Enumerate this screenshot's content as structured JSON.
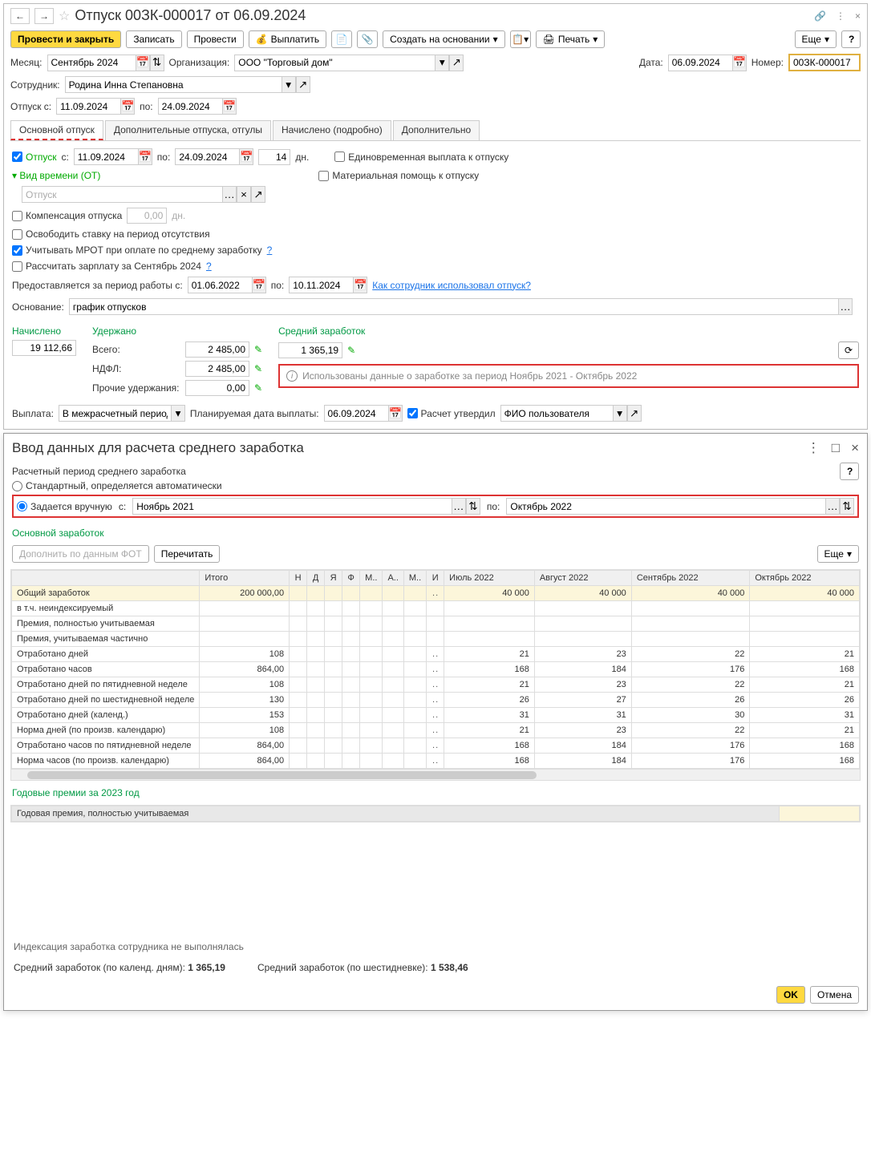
{
  "header": {
    "title": "Отпуск 00ЗК-000017 от 06.09.2024",
    "back": "←",
    "fwd": "→"
  },
  "toolbar": {
    "post_close": "Провести и закрыть",
    "save": "Записать",
    "post": "Провести",
    "pay": "Выплатить",
    "create_base": "Создать на основании",
    "print": "Печать",
    "more": "Еще",
    "help": "?"
  },
  "form": {
    "month_lbl": "Месяц:",
    "month": "Сентябрь 2024",
    "org_lbl": "Организация:",
    "org": "ООО \"Торговый дом\"",
    "date_lbl": "Дата:",
    "date": "06.09.2024",
    "num_lbl": "Номер:",
    "num": "00ЗК-000017",
    "emp_lbl": "Сотрудник:",
    "emp": "Родина Инна Степановна",
    "leave_from_lbl": "Отпуск с:",
    "leave_from": "11.09.2024",
    "to_lbl": "по:",
    "leave_to": "24.09.2024"
  },
  "tabs": {
    "main": "Основной отпуск",
    "add": "Дополнительные отпуска, отгулы",
    "accr": "Начислено (подробно)",
    "extra": "Дополнительно"
  },
  "main_tab": {
    "leave_lbl": "Отпуск",
    "from_lbl": "с:",
    "from": "11.09.2024",
    "to_lbl": "по:",
    "to": "24.09.2024",
    "days": "14",
    "days_lbl": "дн.",
    "lump": "Единовременная выплата к отпуску",
    "mat": "Материальная помощь к отпуску",
    "time_type": "Вид времени (ОТ)",
    "time_type_val": "Отпуск",
    "comp": "Компенсация отпуска",
    "comp_days": "0,00",
    "comp_days_lbl": "дн.",
    "release": "Освободить ставку на период отсутствия",
    "mrot": "Учитывать МРОТ при оплате по среднему заработку",
    "recalc": "Рассчитать зарплату за Сентябрь 2024",
    "provided_lbl": "Предоставляется за период работы с:",
    "provided_from": "01.06.2022",
    "provided_to_lbl": "по:",
    "provided_to": "10.11.2024",
    "how_used": "Как сотрудник использовал отпуск?",
    "basis_lbl": "Основание:",
    "basis": "график отпусков"
  },
  "totals": {
    "accrued_lbl": "Начислено",
    "accrued": "19 112,66",
    "held_lbl": "Удержано",
    "total_lbl": "Всего:",
    "total": "2 485,00",
    "ndfl_lbl": "НДФЛ:",
    "ndfl": "2 485,00",
    "other_lbl": "Прочие удержания:",
    "other": "0,00",
    "avg_lbl": "Средний заработок",
    "avg": "1 365,19",
    "info": "Использованы данные о заработке за период Ноябрь 2021 - Октябрь 2022"
  },
  "payment": {
    "pay_lbl": "Выплата:",
    "pay_val": "В межрасчетный период",
    "plan_date_lbl": "Планируемая дата выплаты:",
    "plan_date": "06.09.2024",
    "approved": "Расчет утвердил",
    "user": "ФИО пользователя"
  },
  "dialog": {
    "title": "Ввод данных для расчета среднего заработка",
    "period_lbl": "Расчетный период среднего заработка",
    "std": "Стандартный, определяется автоматически",
    "manual": "Задается вручную",
    "from_lbl": "с:",
    "from": "Ноябрь 2021",
    "to_lbl": "по:",
    "to": "Октябрь 2022",
    "main_earn": "Основной заработок",
    "supplement": "Дополнить по данным ФОТ",
    "reread": "Перечитать",
    "more": "Еще",
    "annual_bonus": "Годовые премии за 2023 год",
    "annual_bonus_row": "Годовая премия, полностью учитываемая",
    "indexation": "Индексация заработка сотрудника не выполнялась",
    "avg_calendar_lbl": "Средний заработок (по календ. дням):",
    "avg_calendar": "1 365,19",
    "avg_six_lbl": "Средний заработок (по шестидневке):",
    "avg_six": "1 538,46",
    "ok": "OK",
    "cancel": "Отмена",
    "help": "?"
  },
  "table": {
    "cols": {
      "total": "Итого",
      "n": "Н",
      "d": "Д",
      "ya": "Я",
      "f": "Ф",
      "m1": "М..",
      "a1": "А..",
      "m2": "М..",
      "i": "И",
      "jul": "Июль 2022",
      "aug": "Август 2022",
      "sep": "Сентябрь 2022",
      "oct": "Октябрь 2022"
    },
    "rows": [
      {
        "label": "Общий заработок",
        "total": "200 000,00",
        "jul": "40 000",
        "aug": "40 000",
        "sep": "40 000",
        "oct": "40 000",
        "hl": true
      },
      {
        "label": "   в т.ч. неиндексируемый",
        "total": "",
        "jul": "",
        "aug": "",
        "sep": "",
        "oct": ""
      },
      {
        "label": "Премия, полностью учитываемая",
        "total": "",
        "jul": "",
        "aug": "",
        "sep": "",
        "oct": ""
      },
      {
        "label": "Премия, учитываемая частично",
        "total": "",
        "jul": "",
        "aug": "",
        "sep": "",
        "oct": ""
      },
      {
        "label": "Отработано дней",
        "total": "108",
        "jul": "21",
        "aug": "23",
        "sep": "22",
        "oct": "21"
      },
      {
        "label": "Отработано часов",
        "total": "864,00",
        "jul": "168",
        "aug": "184",
        "sep": "176",
        "oct": "168"
      },
      {
        "label": "Отработано дней по пятидневной неделе",
        "total": "108",
        "jul": "21",
        "aug": "23",
        "sep": "22",
        "oct": "21"
      },
      {
        "label": "Отработано дней по шестидневной неделе",
        "total": "130",
        "jul": "26",
        "aug": "27",
        "sep": "26",
        "oct": "26"
      },
      {
        "label": "Отработано дней (календ.)",
        "total": "153",
        "jul": "31",
        "aug": "31",
        "sep": "30",
        "oct": "31"
      },
      {
        "label": "Норма дней (по произв. календарю)",
        "total": "108",
        "jul": "21",
        "aug": "23",
        "sep": "22",
        "oct": "21"
      },
      {
        "label": "Отработано часов по пятидневной неделе",
        "total": "864,00",
        "jul": "168",
        "aug": "184",
        "sep": "176",
        "oct": "168"
      },
      {
        "label": "Норма часов (по произв. календарю)",
        "total": "864,00",
        "jul": "168",
        "aug": "184",
        "sep": "176",
        "oct": "168"
      }
    ]
  }
}
